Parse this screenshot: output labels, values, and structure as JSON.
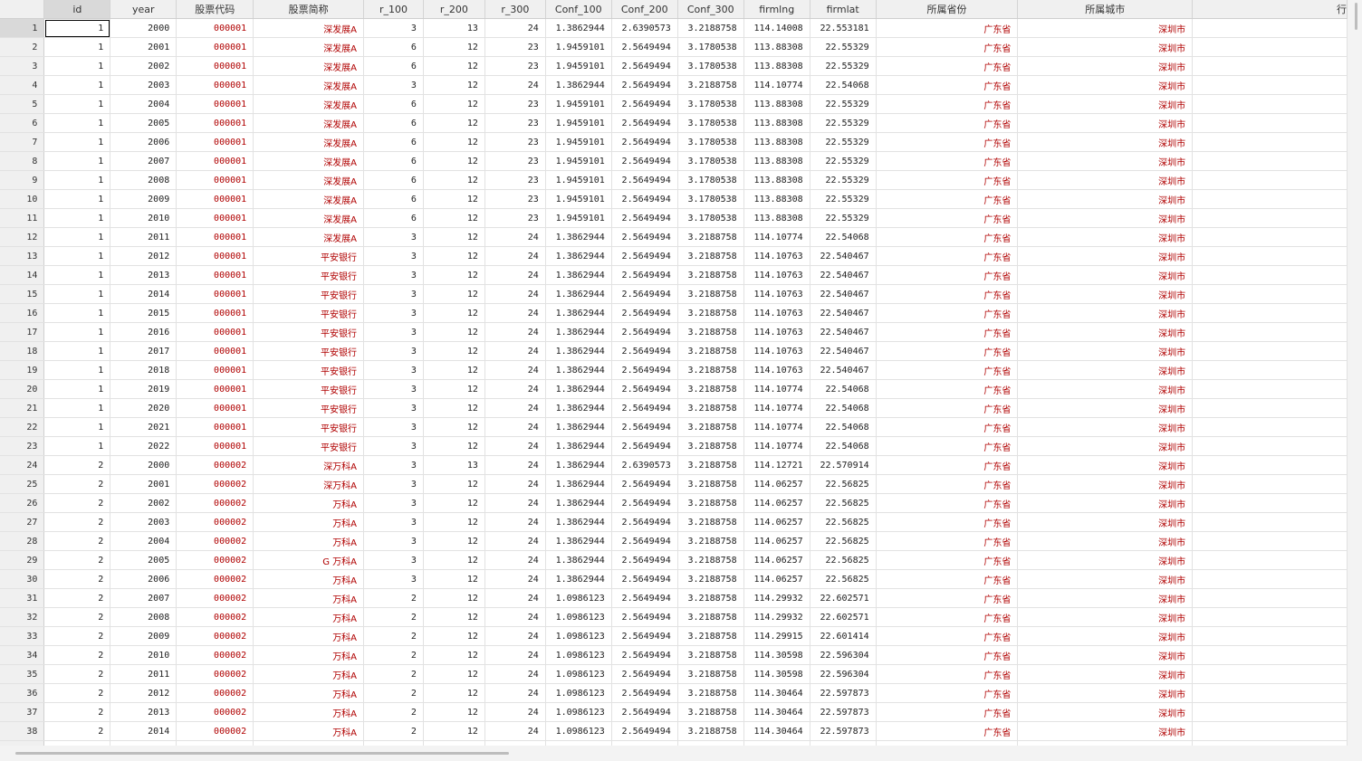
{
  "columns": [
    "id",
    "year",
    "股票代码",
    "股票简称",
    "r_100",
    "r_200",
    "r_300",
    "Conf_100",
    "Conf_200",
    "Conf_300",
    "firmlng",
    "firmlat",
    "所属省份",
    "所属城市",
    "行"
  ],
  "rows": [
    [
      "1",
      "1",
      "2000",
      "000001",
      "深发展A",
      "3",
      "13",
      "24",
      "1.3862944",
      "2.6390573",
      "3.2188758",
      "114.14008",
      "22.553181",
      "广东省",
      "深圳市"
    ],
    [
      "2",
      "1",
      "2001",
      "000001",
      "深发展A",
      "6",
      "12",
      "23",
      "1.9459101",
      "2.5649494",
      "3.1780538",
      "113.88308",
      "22.55329",
      "广东省",
      "深圳市"
    ],
    [
      "3",
      "1",
      "2002",
      "000001",
      "深发展A",
      "6",
      "12",
      "23",
      "1.9459101",
      "2.5649494",
      "3.1780538",
      "113.88308",
      "22.55329",
      "广东省",
      "深圳市"
    ],
    [
      "4",
      "1",
      "2003",
      "000001",
      "深发展A",
      "3",
      "12",
      "24",
      "1.3862944",
      "2.5649494",
      "3.2188758",
      "114.10774",
      "22.54068",
      "广东省",
      "深圳市"
    ],
    [
      "5",
      "1",
      "2004",
      "000001",
      "深发展A",
      "6",
      "12",
      "23",
      "1.9459101",
      "2.5649494",
      "3.1780538",
      "113.88308",
      "22.55329",
      "广东省",
      "深圳市"
    ],
    [
      "6",
      "1",
      "2005",
      "000001",
      "深发展A",
      "6",
      "12",
      "23",
      "1.9459101",
      "2.5649494",
      "3.1780538",
      "113.88308",
      "22.55329",
      "广东省",
      "深圳市"
    ],
    [
      "7",
      "1",
      "2006",
      "000001",
      "深发展A",
      "6",
      "12",
      "23",
      "1.9459101",
      "2.5649494",
      "3.1780538",
      "113.88308",
      "22.55329",
      "广东省",
      "深圳市"
    ],
    [
      "8",
      "1",
      "2007",
      "000001",
      "深发展A",
      "6",
      "12",
      "23",
      "1.9459101",
      "2.5649494",
      "3.1780538",
      "113.88308",
      "22.55329",
      "广东省",
      "深圳市"
    ],
    [
      "9",
      "1",
      "2008",
      "000001",
      "深发展A",
      "6",
      "12",
      "23",
      "1.9459101",
      "2.5649494",
      "3.1780538",
      "113.88308",
      "22.55329",
      "广东省",
      "深圳市"
    ],
    [
      "10",
      "1",
      "2009",
      "000001",
      "深发展A",
      "6",
      "12",
      "23",
      "1.9459101",
      "2.5649494",
      "3.1780538",
      "113.88308",
      "22.55329",
      "广东省",
      "深圳市"
    ],
    [
      "11",
      "1",
      "2010",
      "000001",
      "深发展A",
      "6",
      "12",
      "23",
      "1.9459101",
      "2.5649494",
      "3.1780538",
      "113.88308",
      "22.55329",
      "广东省",
      "深圳市"
    ],
    [
      "12",
      "1",
      "2011",
      "000001",
      "深发展A",
      "3",
      "12",
      "24",
      "1.3862944",
      "2.5649494",
      "3.2188758",
      "114.10774",
      "22.54068",
      "广东省",
      "深圳市"
    ],
    [
      "13",
      "1",
      "2012",
      "000001",
      "平安银行",
      "3",
      "12",
      "24",
      "1.3862944",
      "2.5649494",
      "3.2188758",
      "114.10763",
      "22.540467",
      "广东省",
      "深圳市"
    ],
    [
      "14",
      "1",
      "2013",
      "000001",
      "平安银行",
      "3",
      "12",
      "24",
      "1.3862944",
      "2.5649494",
      "3.2188758",
      "114.10763",
      "22.540467",
      "广东省",
      "深圳市"
    ],
    [
      "15",
      "1",
      "2014",
      "000001",
      "平安银行",
      "3",
      "12",
      "24",
      "1.3862944",
      "2.5649494",
      "3.2188758",
      "114.10763",
      "22.540467",
      "广东省",
      "深圳市"
    ],
    [
      "16",
      "1",
      "2015",
      "000001",
      "平安银行",
      "3",
      "12",
      "24",
      "1.3862944",
      "2.5649494",
      "3.2188758",
      "114.10763",
      "22.540467",
      "广东省",
      "深圳市"
    ],
    [
      "17",
      "1",
      "2016",
      "000001",
      "平安银行",
      "3",
      "12",
      "24",
      "1.3862944",
      "2.5649494",
      "3.2188758",
      "114.10763",
      "22.540467",
      "广东省",
      "深圳市"
    ],
    [
      "18",
      "1",
      "2017",
      "000001",
      "平安银行",
      "3",
      "12",
      "24",
      "1.3862944",
      "2.5649494",
      "3.2188758",
      "114.10763",
      "22.540467",
      "广东省",
      "深圳市"
    ],
    [
      "19",
      "1",
      "2018",
      "000001",
      "平安银行",
      "3",
      "12",
      "24",
      "1.3862944",
      "2.5649494",
      "3.2188758",
      "114.10763",
      "22.540467",
      "广东省",
      "深圳市"
    ],
    [
      "20",
      "1",
      "2019",
      "000001",
      "平安银行",
      "3",
      "12",
      "24",
      "1.3862944",
      "2.5649494",
      "3.2188758",
      "114.10774",
      "22.54068",
      "广东省",
      "深圳市"
    ],
    [
      "21",
      "1",
      "2020",
      "000001",
      "平安银行",
      "3",
      "12",
      "24",
      "1.3862944",
      "2.5649494",
      "3.2188758",
      "114.10774",
      "22.54068",
      "广东省",
      "深圳市"
    ],
    [
      "22",
      "1",
      "2021",
      "000001",
      "平安银行",
      "3",
      "12",
      "24",
      "1.3862944",
      "2.5649494",
      "3.2188758",
      "114.10774",
      "22.54068",
      "广东省",
      "深圳市"
    ],
    [
      "23",
      "1",
      "2022",
      "000001",
      "平安银行",
      "3",
      "12",
      "24",
      "1.3862944",
      "2.5649494",
      "3.2188758",
      "114.10774",
      "22.54068",
      "广东省",
      "深圳市"
    ],
    [
      "24",
      "2",
      "2000",
      "000002",
      "深万科A",
      "3",
      "13",
      "24",
      "1.3862944",
      "2.6390573",
      "3.2188758",
      "114.12721",
      "22.570914",
      "广东省",
      "深圳市"
    ],
    [
      "25",
      "2",
      "2001",
      "000002",
      "深万科A",
      "3",
      "12",
      "24",
      "1.3862944",
      "2.5649494",
      "3.2188758",
      "114.06257",
      "22.56825",
      "广东省",
      "深圳市"
    ],
    [
      "26",
      "2",
      "2002",
      "000002",
      "万科A",
      "3",
      "12",
      "24",
      "1.3862944",
      "2.5649494",
      "3.2188758",
      "114.06257",
      "22.56825",
      "广东省",
      "深圳市"
    ],
    [
      "27",
      "2",
      "2003",
      "000002",
      "万科A",
      "3",
      "12",
      "24",
      "1.3862944",
      "2.5649494",
      "3.2188758",
      "114.06257",
      "22.56825",
      "广东省",
      "深圳市"
    ],
    [
      "28",
      "2",
      "2004",
      "000002",
      "万科A",
      "3",
      "12",
      "24",
      "1.3862944",
      "2.5649494",
      "3.2188758",
      "114.06257",
      "22.56825",
      "广东省",
      "深圳市"
    ],
    [
      "29",
      "2",
      "2005",
      "000002",
      "G 万科A",
      "3",
      "12",
      "24",
      "1.3862944",
      "2.5649494",
      "3.2188758",
      "114.06257",
      "22.56825",
      "广东省",
      "深圳市"
    ],
    [
      "30",
      "2",
      "2006",
      "000002",
      "万科A",
      "3",
      "12",
      "24",
      "1.3862944",
      "2.5649494",
      "3.2188758",
      "114.06257",
      "22.56825",
      "广东省",
      "深圳市"
    ],
    [
      "31",
      "2",
      "2007",
      "000002",
      "万科A",
      "2",
      "12",
      "24",
      "1.0986123",
      "2.5649494",
      "3.2188758",
      "114.29932",
      "22.602571",
      "广东省",
      "深圳市"
    ],
    [
      "32",
      "2",
      "2008",
      "000002",
      "万科A",
      "2",
      "12",
      "24",
      "1.0986123",
      "2.5649494",
      "3.2188758",
      "114.29932",
      "22.602571",
      "广东省",
      "深圳市"
    ],
    [
      "33",
      "2",
      "2009",
      "000002",
      "万科A",
      "2",
      "12",
      "24",
      "1.0986123",
      "2.5649494",
      "3.2188758",
      "114.29915",
      "22.601414",
      "广东省",
      "深圳市"
    ],
    [
      "34",
      "2",
      "2010",
      "000002",
      "万科A",
      "2",
      "12",
      "24",
      "1.0986123",
      "2.5649494",
      "3.2188758",
      "114.30598",
      "22.596304",
      "广东省",
      "深圳市"
    ],
    [
      "35",
      "2",
      "2011",
      "000002",
      "万科A",
      "2",
      "12",
      "24",
      "1.0986123",
      "2.5649494",
      "3.2188758",
      "114.30598",
      "22.596304",
      "广东省",
      "深圳市"
    ],
    [
      "36",
      "2",
      "2012",
      "000002",
      "万科A",
      "2",
      "12",
      "24",
      "1.0986123",
      "2.5649494",
      "3.2188758",
      "114.30464",
      "22.597873",
      "广东省",
      "深圳市"
    ],
    [
      "37",
      "2",
      "2013",
      "000002",
      "万科A",
      "2",
      "12",
      "24",
      "1.0986123",
      "2.5649494",
      "3.2188758",
      "114.30464",
      "22.597873",
      "广东省",
      "深圳市"
    ],
    [
      "38",
      "2",
      "2014",
      "000002",
      "万科A",
      "2",
      "12",
      "24",
      "1.0986123",
      "2.5649494",
      "3.2188758",
      "114.30464",
      "22.597873",
      "广东省",
      "深圳市"
    ]
  ],
  "partial_row": [
    "",
    "",
    "",
    "",
    "万科A",
    "",
    "",
    "",
    "",
    "",
    "",
    "",
    "",
    "广东省",
    "深圳市"
  ],
  "colors": {
    "text_string": "#b00000",
    "header_bg": "#f0f0f0",
    "grid_line": "#e2e2e2"
  }
}
